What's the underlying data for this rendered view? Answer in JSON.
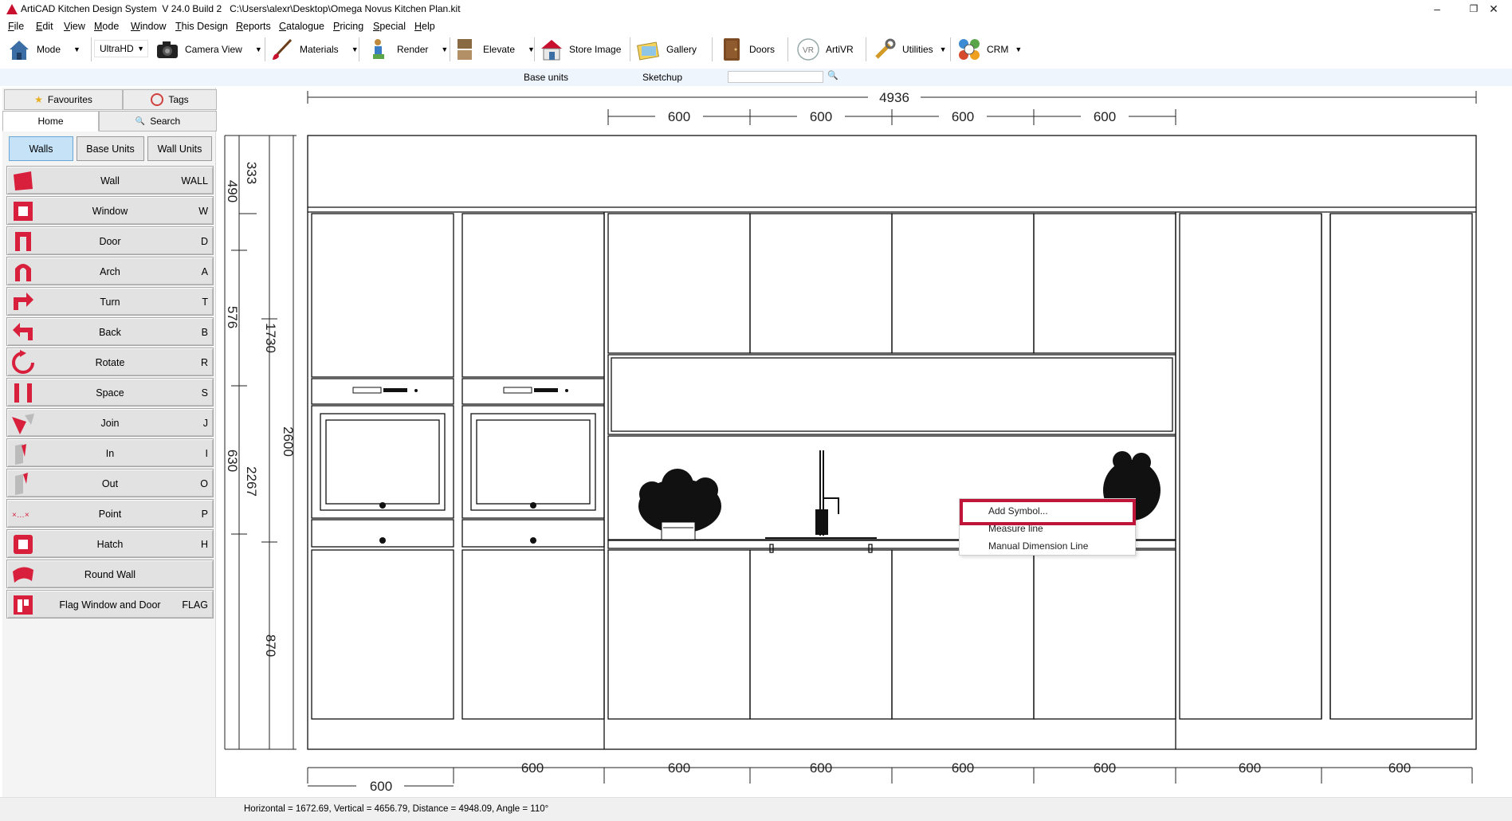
{
  "window": {
    "title": "ArtiCAD Kitchen Design System  V 24.0 Build 2   C:\\Users\\alexr\\Desktop\\Omega Novus Kitchen Plan.kit",
    "minimize": "–",
    "maximize": "❐",
    "close": "✕"
  },
  "menu": [
    {
      "u": "F",
      "rest": "ile"
    },
    {
      "u": "E",
      "rest": "dit"
    },
    {
      "u": "V",
      "rest": "iew"
    },
    {
      "u": "M",
      "rest": "ode"
    },
    {
      "u": "W",
      "rest": "indow"
    },
    {
      "u": "T",
      "rest": "his Design"
    },
    {
      "u": "R",
      "rest": "eports"
    },
    {
      "u": "C",
      "rest": "atalogue"
    },
    {
      "u": "P",
      "rest": "ricing"
    },
    {
      "u": "S",
      "rest": "pecial"
    },
    {
      "u": "H",
      "rest": "elp"
    }
  ],
  "toolbar": {
    "mode": "Mode",
    "quality": "UltraHD",
    "camera_view": "Camera View",
    "materials": "Materials",
    "render": "Render",
    "elevate": "Elevate",
    "store_image": "Store Image",
    "gallery": "Gallery",
    "doors": "Doors",
    "artivr": "ArtiVR",
    "utilities": "Utilities",
    "crm": "CRM",
    "dropdown_arrow": "▼"
  },
  "subbar": {
    "base_units": "Base units",
    "sketchup": "Sketchup",
    "search_value": ""
  },
  "panel": {
    "tab_favourites": "Favourites",
    "tab_tags": "Tags",
    "tab_home": "Home",
    "tab_search": "Search",
    "seg_walls": "Walls",
    "seg_base_units": "Base Units",
    "seg_wall_units": "Wall Units",
    "tools": [
      {
        "name": "Wall",
        "key": "WALL",
        "icon": "wall-icon"
      },
      {
        "name": "Window",
        "key": "W",
        "icon": "window-icon"
      },
      {
        "name": "Door",
        "key": "D",
        "icon": "door-icon"
      },
      {
        "name": "Arch",
        "key": "A",
        "icon": "arch-icon"
      },
      {
        "name": "Turn",
        "key": "T",
        "icon": "turn-icon"
      },
      {
        "name": "Back",
        "key": "B",
        "icon": "back-icon"
      },
      {
        "name": "Rotate",
        "key": "R",
        "icon": "rotate-icon"
      },
      {
        "name": "Space",
        "key": "S",
        "icon": "space-icon"
      },
      {
        "name": "Join",
        "key": "J",
        "icon": "join-icon"
      },
      {
        "name": "In",
        "key": "I",
        "icon": "in-icon"
      },
      {
        "name": "Out",
        "key": "O",
        "icon": "out-icon"
      },
      {
        "name": "Point",
        "key": "P",
        "icon": "point-icon"
      },
      {
        "name": "Hatch",
        "key": "H",
        "icon": "hatch-icon"
      },
      {
        "name": "Round Wall",
        "key": "",
        "icon": "round-wall-icon"
      },
      {
        "name": "Flag Window and Door",
        "key": "FLAG",
        "icon": "flag-icon"
      }
    ]
  },
  "drawing": {
    "total_width": "4936",
    "unit_width": "600",
    "left_dims": [
      "333",
      "490",
      "576",
      "630",
      "1730",
      "2267",
      "870"
    ],
    "height_total": "2600"
  },
  "context_menu": {
    "items": [
      "Add Symbol...",
      "Measure line",
      "Manual Dimension Line"
    ],
    "highlight_color": "#c0153a"
  },
  "status": "Horizontal = 1672.69, Vertical = 4656.79, Distance = 4948.09, Angle = 110°"
}
